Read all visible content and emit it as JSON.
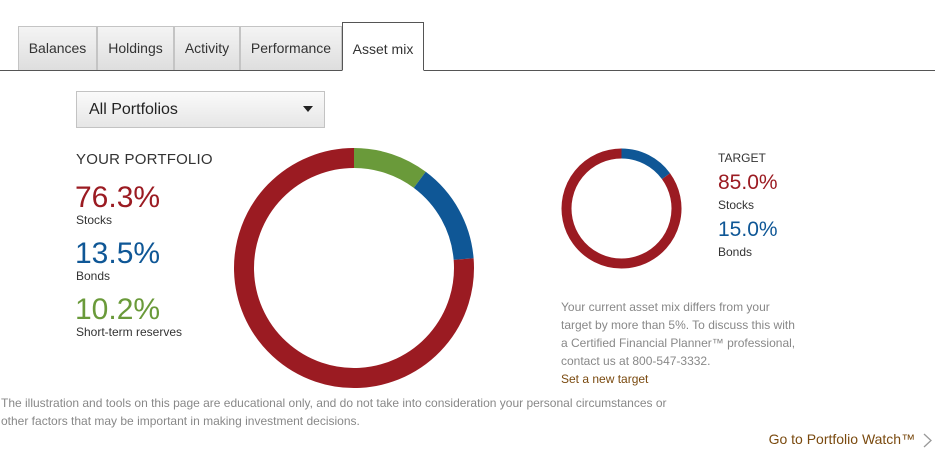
{
  "tabs": [
    {
      "label": "Balances"
    },
    {
      "label": "Holdings"
    },
    {
      "label": "Activity"
    },
    {
      "label": "Performance"
    },
    {
      "label": "Asset mix",
      "active": true
    }
  ],
  "portfolio_select": {
    "value": "All Portfolios"
  },
  "your_portfolio": {
    "heading": "YOUR PORTFOLIO",
    "items": [
      {
        "value": "76.3%",
        "label": "Stocks",
        "color": "#9b1b22"
      },
      {
        "value": "13.5%",
        "label": "Bonds",
        "color": "#0f5796"
      },
      {
        "value": "10.2%",
        "label": "Short-term reserves",
        "color": "#6a9a3a"
      }
    ]
  },
  "target": {
    "heading": "TARGET",
    "items": [
      {
        "value": "85.0%",
        "label": "Stocks",
        "color": "#9b1b22"
      },
      {
        "value": "15.0%",
        "label": "Bonds",
        "color": "#0f5796"
      }
    ]
  },
  "chart_data": [
    {
      "type": "pie",
      "categories": [
        "Stocks",
        "Bonds",
        "Short-term reserves"
      ],
      "values": [
        76.3,
        13.5,
        10.2
      ],
      "colors": [
        "#9b1b22",
        "#0f5796",
        "#6a9a3a"
      ],
      "order_clockwise_from_top": [
        "Short-term reserves",
        "Bonds",
        "Stocks"
      ],
      "style": "donut"
    },
    {
      "type": "pie",
      "categories": [
        "Stocks",
        "Bonds"
      ],
      "values": [
        85.0,
        15.0
      ],
      "colors": [
        "#9b1b22",
        "#0f5796"
      ],
      "order_clockwise_from_top": [
        "Bonds",
        "Stocks"
      ],
      "style": "donut"
    }
  ],
  "note": {
    "text": "Your current asset mix differs from your target by more than 5%. To discuss this with a Certified Financial Planner™ professional, contact us at 800-547-3332.",
    "link": "Set a new target"
  },
  "disclaimer": "The illustration and tools on this page are educational only, and do not take into consideration your personal circumstances or other factors that may be important in making investment decisions.",
  "portfolio_watch_link": "Go to Portfolio Watch™"
}
